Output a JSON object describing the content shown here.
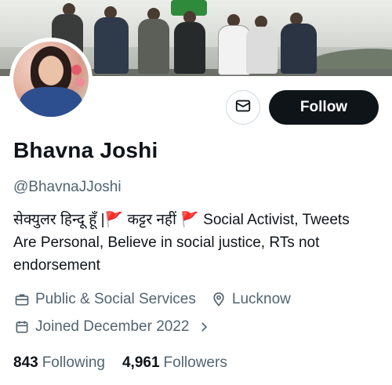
{
  "profile": {
    "name": "Bhavna Joshi",
    "handle": "@BhavnaJJoshi",
    "bio": "सेक्युलर हिन्दू हूँ |🚩 कट्टर नहीं 🚩 Social Activist, Tweets\nAre Personal, Believe in social justice, RTs not\nendorsement",
    "category": "Public & Social Services",
    "location": "Lucknow",
    "joined": "Joined December 2022"
  },
  "actions": {
    "follow_label": "Follow"
  },
  "stats": {
    "following_count": "843",
    "following_label": "Following",
    "followers_count": "4,961",
    "followers_label": "Followers"
  },
  "icons": {
    "message": "envelope-icon",
    "category": "briefcase-icon",
    "location": "location-pin-icon",
    "joined": "calendar-icon",
    "chevron": "chevron-right-icon"
  },
  "colors": {
    "text": "#0f1419",
    "secondary": "#536471",
    "follow_bg": "#0f1419",
    "border": "#cfd9de"
  }
}
